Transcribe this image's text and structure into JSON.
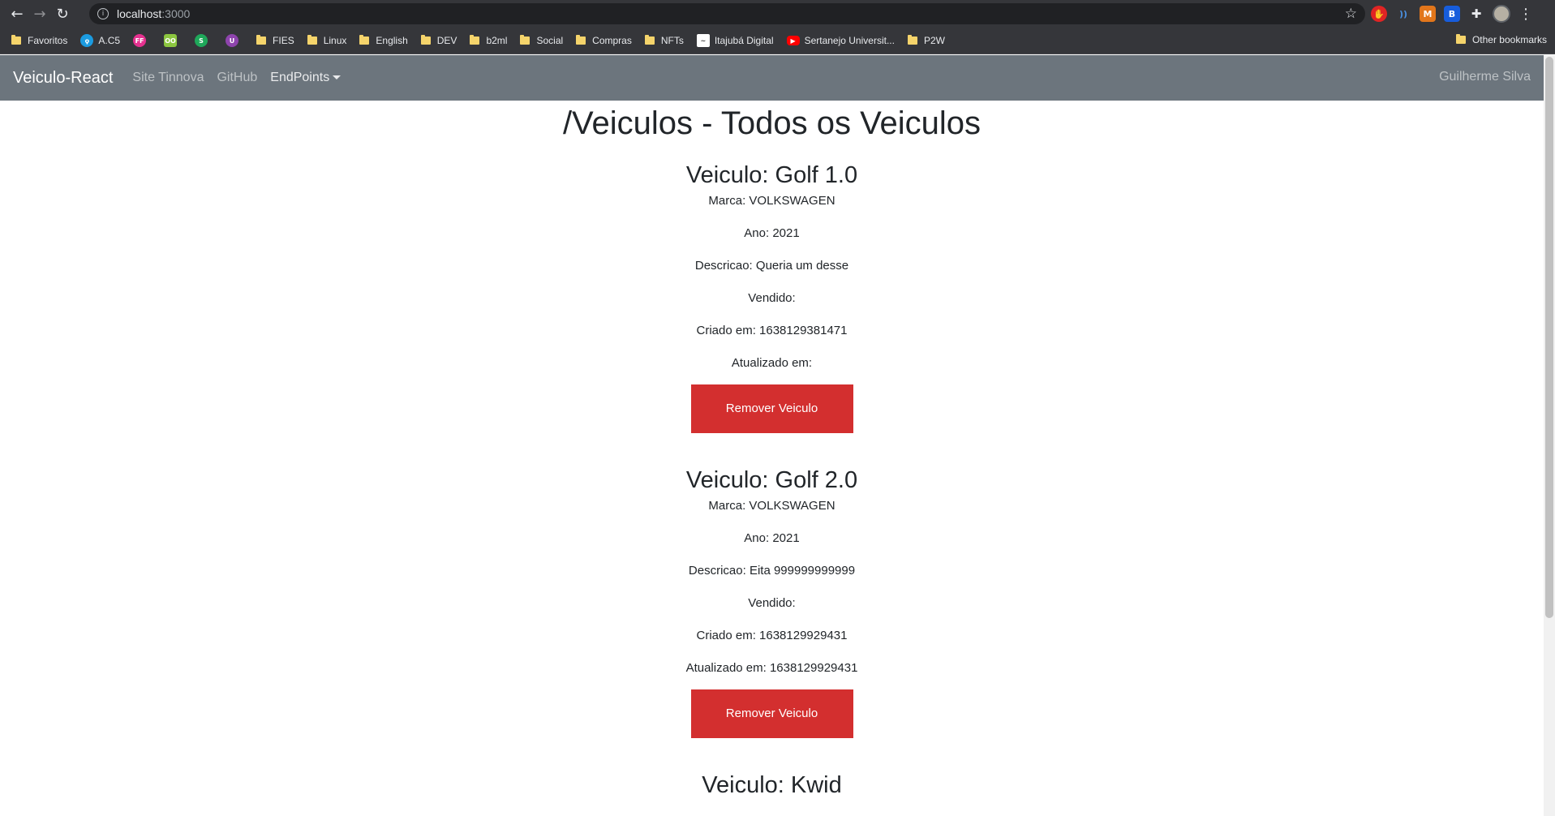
{
  "browser": {
    "url_host": "localhost",
    "url_port": ":3000",
    "bookmarks": [
      {
        "label": "Favoritos",
        "icon": "folder-icon"
      },
      {
        "label": "A.C5",
        "icon": "ac5-icon"
      },
      {
        "label": "",
        "icon": "ff-icon",
        "badge": "FF"
      },
      {
        "label": "",
        "icon": "oo-icon",
        "badge": "OO"
      },
      {
        "label": "",
        "icon": "swirl-icon",
        "badge": "S"
      },
      {
        "label": "",
        "icon": "purple-icon",
        "badge": "U"
      },
      {
        "label": "FIES",
        "icon": "folder-icon"
      },
      {
        "label": "Linux",
        "icon": "folder-icon"
      },
      {
        "label": "English",
        "icon": "folder-icon"
      },
      {
        "label": "DEV",
        "icon": "folder-icon"
      },
      {
        "label": "b2ml",
        "icon": "folder-icon"
      },
      {
        "label": "Social",
        "icon": "folder-icon"
      },
      {
        "label": "Compras",
        "icon": "folder-icon"
      },
      {
        "label": "NFTs",
        "icon": "folder-icon"
      },
      {
        "label": "Itajubá Digital",
        "icon": "itajuba-icon"
      },
      {
        "label": "Sertanejo Universit...",
        "icon": "youtube-icon"
      },
      {
        "label": "P2W",
        "icon": "folder-icon"
      }
    ],
    "other_bookmarks": "Other bookmarks"
  },
  "navbar": {
    "brand": "Veiculo-React",
    "links": [
      "Site Tinnova",
      "GitHub"
    ],
    "dropdown": "EndPoints",
    "user": "Guilherme Silva"
  },
  "page": {
    "title": "/Veiculos - Todos os Veiculos",
    "remove_label": "Remover Veiculo"
  },
  "vehicles": [
    {
      "name": "Veiculo: Golf 1.0",
      "marca": "Marca: VOLKSWAGEN",
      "ano": "Ano: 2021",
      "descricao": "Descricao: Queria um desse",
      "vendido": "Vendido:",
      "criado": "Criado em: 1638129381471",
      "atualizado": "Atualizado em:"
    },
    {
      "name": "Veiculo: Golf 2.0",
      "marca": "Marca: VOLKSWAGEN",
      "ano": "Ano: 2021",
      "descricao": "Descricao: Eita 999999999999",
      "vendido": "Vendido:",
      "criado": "Criado em: 1638129929431",
      "atualizado": "Atualizado em: 1638129929431"
    },
    {
      "name": "Veiculo: Kwid"
    }
  ]
}
